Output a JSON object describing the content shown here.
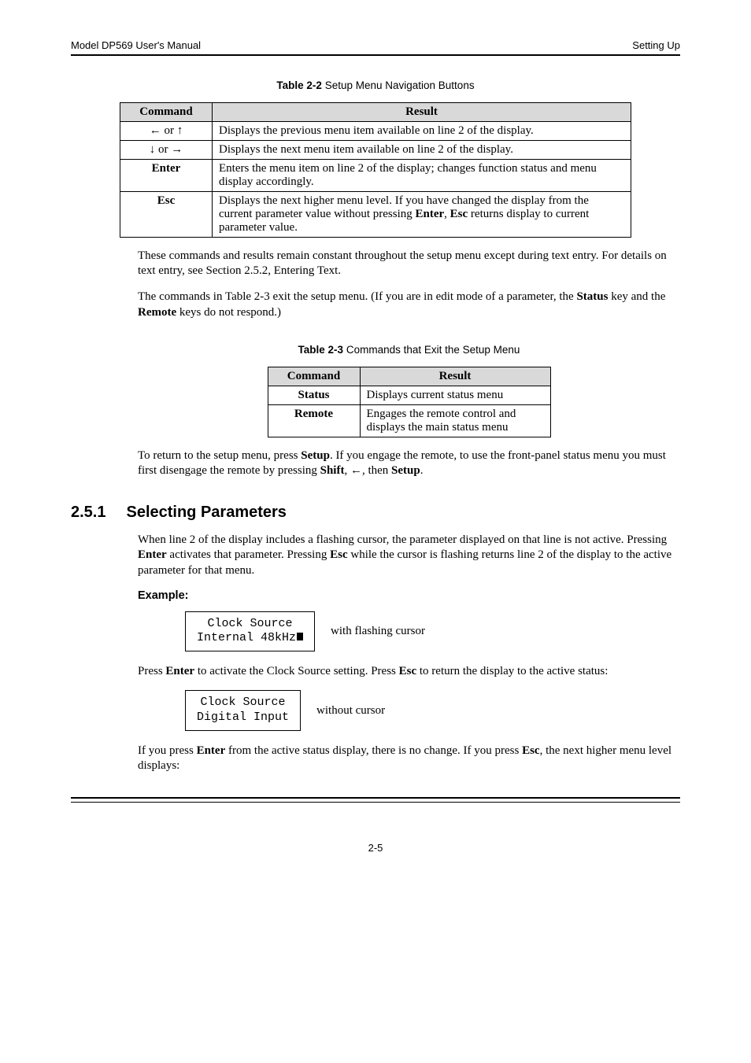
{
  "header": {
    "left": "Model DP569 User's Manual",
    "right": "Setting Up"
  },
  "tables": {
    "t22": {
      "caption_bold": "Table 2-2",
      "caption_rest": "Setup Menu Navigation Buttons",
      "head": {
        "c1": "Command",
        "c2": "Result"
      },
      "rows": [
        {
          "cmd": "← or ↑",
          "res": "Displays the previous menu item available on line 2 of the display."
        },
        {
          "cmd": "↓ or →",
          "res": "Displays the next menu item available on line 2 of the display."
        },
        {
          "cmd": "Enter",
          "res": "Enters the menu item on line 2 of the display; changes function status and menu display accordingly."
        },
        {
          "cmd": "Esc",
          "res_pre": "Displays the next higher menu level. If you have changed the display from the current parameter value without pressing ",
          "res_bold1": "Enter",
          "res_mid": ", ",
          "res_bold2": "Esc",
          "res_post": " returns display to current parameter value."
        }
      ]
    },
    "t23": {
      "caption_bold": "Table 2-3",
      "caption_rest": "Commands that Exit the Setup Menu",
      "head": {
        "c1": "Command",
        "c2": "Result"
      },
      "rows": [
        {
          "cmd": "Status",
          "res": "Displays current status menu"
        },
        {
          "cmd": "Remote",
          "res": "Engages the remote control and displays the main status menu"
        }
      ]
    }
  },
  "paras": {
    "p1": "These commands and results remain constant throughout the setup menu except during text entry. For details on text entry, see Section 2.5.2, Entering Text.",
    "p2_pre": "The commands in Table 2-3 exit the setup menu. (If you are in edit mode of a parameter, the ",
    "p2_b1": "Status",
    "p2_mid": " key and the ",
    "p2_b2": "Remote",
    "p2_post": " keys do not respond.)",
    "p3_pre": "To return to the setup menu, press ",
    "p3_b1": "Setup",
    "p3_mid": ". If you engage the remote, to use the front-panel status menu you must first disengage the remote by pressing ",
    "p3_b2": "Shift",
    "p3_mid2": ", ←, then ",
    "p3_b3": "Setup",
    "p3_post": ".",
    "sec_num": "2.5.1",
    "sec_title": "Selecting Parameters",
    "p4_pre": "When line 2 of the display includes a flashing cursor, the parameter displayed on that line is not active. Pressing ",
    "p4_b1": "Enter",
    "p4_mid": " activates that parameter. Pressing ",
    "p4_b2": "Esc",
    "p4_post": " while the cursor is flashing returns line 2 of the display to the active parameter for that menu.",
    "example_label": "Example:",
    "p5_pre": "Press ",
    "p5_b1": "Enter",
    "p5_mid": " to activate the Clock Source setting. Press ",
    "p5_b2": "Esc",
    "p5_post": " to return the display to the active status:",
    "p6_pre": "If you press ",
    "p6_b1": "Enter",
    "p6_mid": " from the active status display, there is no change. If you press ",
    "p6_b2": "Esc",
    "p6_post": ", the next higher menu level displays:"
  },
  "lcd": {
    "box1_l1": "Clock Source",
    "box1_l2": "Internal 48kHz",
    "box1_note": "with flashing cursor",
    "box2_l1": "Clock Source",
    "box2_l2": "Digital Input",
    "box2_note": "without cursor"
  },
  "footer": {
    "page": "2-5"
  }
}
